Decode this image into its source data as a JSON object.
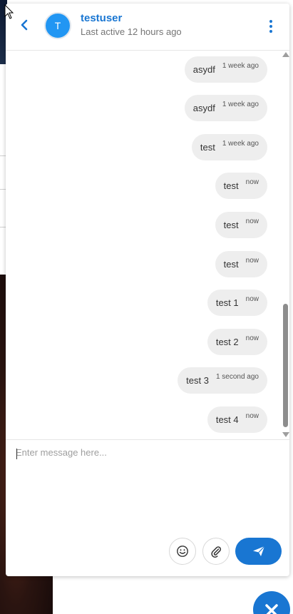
{
  "header": {
    "contact_name": "testuser",
    "avatar_initial": "T",
    "last_active": "Last active 12 hours ago"
  },
  "messages": [
    {
      "text": "asydf",
      "time": "1 week ago"
    },
    {
      "text": "asydf",
      "time": "1 week ago"
    },
    {
      "text": "test",
      "time": "1 week ago"
    },
    {
      "text": "test",
      "time": "now"
    },
    {
      "text": "test",
      "time": "now"
    },
    {
      "text": "test",
      "time": "now"
    },
    {
      "text": "test 1",
      "time": "now"
    },
    {
      "text": "test 2",
      "time": "now"
    },
    {
      "text": "test 3",
      "time": "1 second ago"
    },
    {
      "text": "test 4",
      "time": "now"
    }
  ],
  "composer": {
    "placeholder": "Enter message here...",
    "value": ""
  },
  "icons": {
    "back": "chevron-left-icon",
    "more": "more-vertical-icon",
    "emoji": "emoji-icon",
    "attach": "paperclip-icon",
    "send": "send-icon",
    "close": "close-icon"
  },
  "colors": {
    "accent": "#1976d2",
    "avatar": "#2196f3",
    "bubble": "#eeeeee"
  }
}
